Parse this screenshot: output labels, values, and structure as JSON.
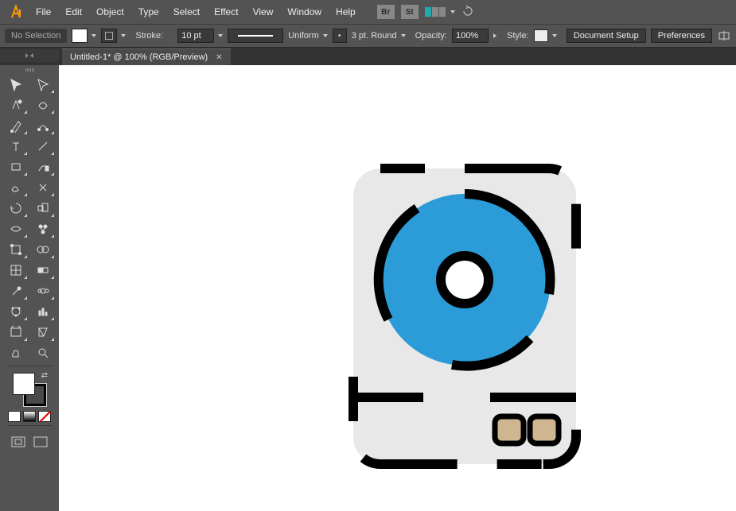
{
  "menu": {
    "items": [
      "File",
      "Edit",
      "Object",
      "Type",
      "Select",
      "Effect",
      "View",
      "Window",
      "Help"
    ],
    "brand_br": "Br",
    "brand_st": "St"
  },
  "control": {
    "selection": "No Selection",
    "stroke_label": "Stroke:",
    "stroke_value": "10 pt",
    "profile_label": "Uniform",
    "brush_label": "3 pt. Round",
    "opacity_label": "Opacity:",
    "opacity_value": "100%",
    "style_label": "Style:",
    "btn_docsetup": "Document Setup",
    "btn_prefs": "Preferences"
  },
  "tab": {
    "title": "Untitled-1* @ 100% (RGB/Preview)"
  },
  "tools": {
    "list": [
      "selection-tool",
      "direct-selection-tool",
      "magic-wand-tool",
      "lasso-tool",
      "pen-tool",
      "curvature-tool",
      "type-tool",
      "line-tool",
      "rectangle-tool",
      "paintbrush-tool",
      "shaper-tool",
      "scissors-tool",
      "rotate-tool",
      "scale-tool",
      "width-tool",
      "puppet-warp-tool",
      "free-transform-tool",
      "shape-builder-tool",
      "mesh-tool",
      "gradient-tool",
      "eyedropper-tool",
      "blend-tool",
      "symbol-sprayer-tool",
      "column-graph-tool",
      "artboard-tool",
      "slice-tool",
      "hand-tool",
      "zoom-tool"
    ]
  },
  "artwork": {
    "disc_color": "#2b9cd8",
    "body_color": "#e8e8e8",
    "button_color": "#cfb691",
    "outline": "#000000"
  }
}
